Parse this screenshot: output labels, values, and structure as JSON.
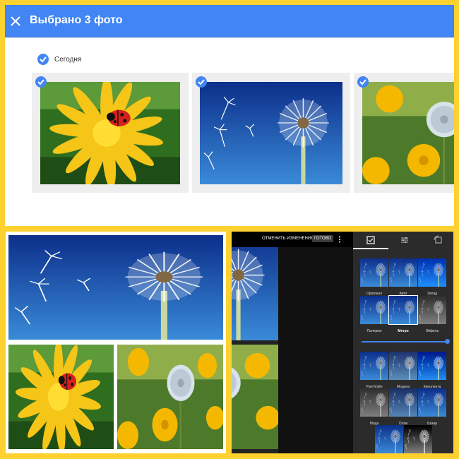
{
  "header": {
    "title": "Выбрано 3 фото"
  },
  "section": {
    "label": "Сегодня"
  },
  "photos": [
    {
      "subject": "ladybug-dandelion"
    },
    {
      "subject": "dandelion-seeds"
    },
    {
      "subject": "dandelion-field"
    }
  ],
  "editor": {
    "undo_label": "ОТМЕНИТЬ ИЗМЕНЕНИЯ",
    "done_label": "ГОТОВО",
    "filters": [
      {
        "label": "Оригинал"
      },
      {
        "label": "Авто"
      },
      {
        "label": "Запад"
      },
      {
        "label": "Палермо"
      },
      {
        "label": "Метро"
      },
      {
        "label": "Эйфель"
      },
      {
        "label": "Рум Мэйн"
      },
      {
        "label": "Модена"
      },
      {
        "label": "Кинолента"
      },
      {
        "label": "Мода"
      },
      {
        "label": "Олли"
      },
      {
        "label": "Базар"
      }
    ],
    "selected_filter": "Метро"
  },
  "colors": {
    "accent": "#4285f4",
    "frame": "#fdd12f"
  }
}
